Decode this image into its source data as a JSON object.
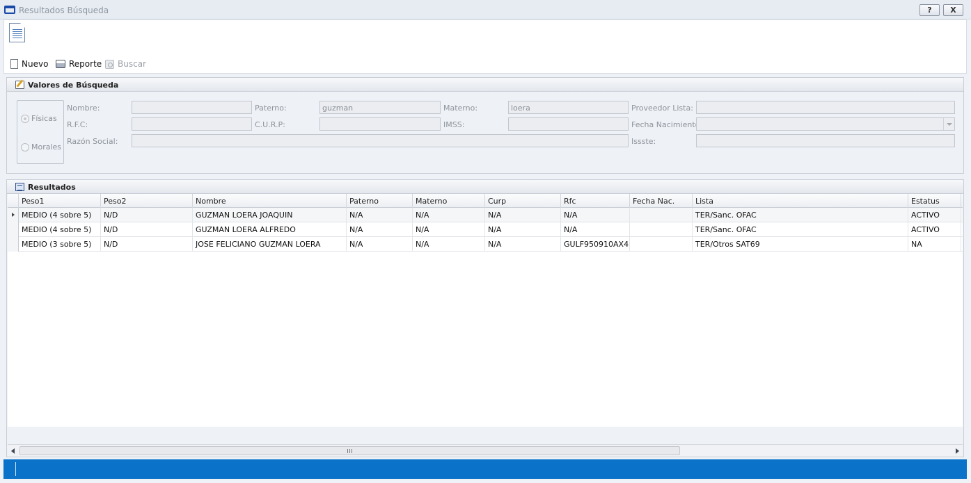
{
  "window": {
    "title": "Resultados Búsqueda",
    "help_label": "?",
    "close_label": "X"
  },
  "toolbar": {
    "new_label": "Nuevo",
    "report_label": "Reporte",
    "search_label": "Buscar"
  },
  "search_panel": {
    "title": "Valores de Búsqueda",
    "radio_fisicas": "Físicas",
    "radio_morales": "Morales",
    "labels": {
      "nombre": "Nombre:",
      "paterno": "Paterno:",
      "materno": "Materno:",
      "proveedor": "Proveedor Lista:",
      "rfc": "R.F.C:",
      "curp": "C.U.R.P:",
      "imss": "IMSS:",
      "fecha": "Fecha Nacimiento:",
      "razon": "Razón Social:",
      "issste": "Issste:"
    },
    "values": {
      "nombre": "",
      "paterno": "guzman",
      "materno": "loera",
      "proveedor": "",
      "rfc": "",
      "curp": "",
      "imss": "",
      "fecha": "",
      "razon": "",
      "issste": ""
    }
  },
  "results_panel": {
    "title": "Resultados",
    "columns": [
      "Peso1",
      "Peso2",
      "Nombre",
      "Paterno",
      "Materno",
      "Curp",
      "Rfc",
      "Fecha Nac.",
      "Lista",
      "Estatus"
    ],
    "rows": [
      [
        "MEDIO (4 sobre 5)",
        "N/D",
        "GUZMAN LOERA JOAQUIN",
        "N/A",
        "N/A",
        "N/A",
        "N/A",
        "",
        "TER/Sanc. OFAC",
        "ACTIVO"
      ],
      [
        "MEDIO (4 sobre 5)",
        "N/D",
        "GUZMAN LOERA ALFREDO",
        "N/A",
        "N/A",
        "N/A",
        "N/A",
        "",
        "TER/Sanc. OFAC",
        "ACTIVO"
      ],
      [
        "MEDIO (3 sobre 5)",
        "N/D",
        "JOSE FELICIANO GUZMAN LOERA",
        "N/A",
        "N/A",
        "N/A",
        "GULF950910AX4",
        "",
        "TER/Otros SAT69",
        "NA"
      ]
    ]
  },
  "colors": {
    "statusbar": "#0a72c8",
    "app_icon": "#1a4aa8"
  }
}
